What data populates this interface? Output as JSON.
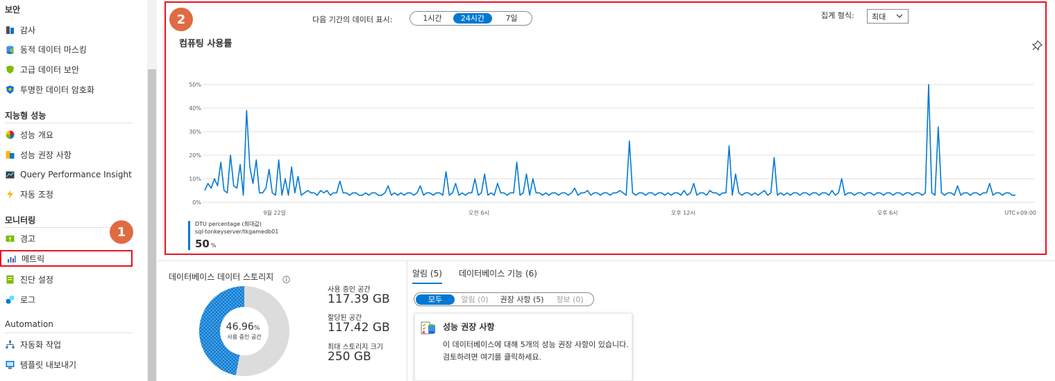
{
  "sidebar": {
    "sections": [
      {
        "title": "보안",
        "items": [
          {
            "label": "감사",
            "icon": "audit-icon"
          },
          {
            "label": "동적 데이터 마스킹",
            "icon": "data-masking-icon"
          },
          {
            "label": "고급 데이터 보안",
            "icon": "advanced-security-icon"
          },
          {
            "label": "투명한 데이터 암호화",
            "icon": "encryption-shield-icon"
          }
        ]
      },
      {
        "title": "지능형 성능",
        "items": [
          {
            "label": "성능 개요",
            "icon": "performance-overview-icon"
          },
          {
            "label": "성능 권장 사항",
            "icon": "performance-recommendations-icon"
          },
          {
            "label": "Query Performance Insight",
            "icon": "query-insight-icon"
          },
          {
            "label": "자동 조정",
            "icon": "lightning-icon"
          }
        ]
      },
      {
        "title": "모니터링",
        "items": [
          {
            "label": "경고",
            "icon": "alert-icon"
          },
          {
            "label": "메트릭",
            "icon": "metrics-icon",
            "selected": true
          },
          {
            "label": "진단 설정",
            "icon": "diagnostic-settings-icon"
          },
          {
            "label": "로그",
            "icon": "logs-icon"
          }
        ]
      },
      {
        "title": "Automation",
        "items": [
          {
            "label": "자동화 작업",
            "icon": "automation-tasks-icon"
          },
          {
            "label": "템플릿 내보내기",
            "icon": "export-template-icon"
          }
        ]
      }
    ]
  },
  "badges": {
    "one": "1",
    "two": "2",
    "color": "#e06b42"
  },
  "chart_panel": {
    "period_label": "다음 기간의 데이터 표시:",
    "period_options": [
      "1시간",
      "24시간",
      "7일"
    ],
    "period_selected": "24시간",
    "agg_label": "집계 형식:",
    "agg_value": "최대",
    "title": "컴퓨팅 사용률",
    "legend": {
      "metric": "DTU percentage (최대값)",
      "resource": "sql-tonkeyserver/tkgamedb01",
      "value": "50",
      "unit": "%"
    }
  },
  "chart_data": {
    "type": "line",
    "title": "컴퓨팅 사용률",
    "y_ticks": [
      "0%",
      "10%",
      "20%",
      "30%",
      "40%",
      "50%"
    ],
    "ylim": [
      0,
      50
    ],
    "x_tick_labels": [
      "9월 22일",
      "오전 6시",
      "오후 12시",
      "오후 6시"
    ],
    "timezone_label": "UTC+09:00",
    "grid": true,
    "series": [
      {
        "name": "DTU percentage (최대값)",
        "color": "#0078d4",
        "values": [
          5,
          8,
          6,
          10,
          7,
          17,
          5,
          4,
          20,
          7,
          6,
          16,
          3,
          39,
          15,
          8,
          18,
          4,
          4,
          6,
          14,
          4,
          3,
          18,
          3,
          10,
          3,
          15,
          4,
          11,
          3,
          4,
          5,
          4,
          4,
          3,
          5,
          4,
          5,
          3,
          4,
          4,
          9,
          4,
          4,
          3,
          4,
          4,
          3,
          3,
          4,
          3,
          4,
          4,
          3,
          3,
          4,
          7,
          3,
          4,
          3,
          4,
          3,
          4,
          4,
          3,
          4,
          7,
          3,
          4,
          4,
          3,
          4,
          4,
          3,
          13,
          3,
          4,
          8,
          3,
          4,
          3,
          4,
          4,
          10,
          3,
          4,
          12,
          3,
          4,
          3,
          8,
          4,
          4,
          3,
          4,
          4,
          17,
          3,
          4,
          12,
          3,
          10,
          4,
          4,
          3,
          4,
          3,
          4,
          4,
          3,
          4,
          4,
          3,
          4,
          6,
          3,
          4,
          4,
          5,
          3,
          4,
          4,
          3,
          4,
          4,
          3,
          4,
          4,
          5,
          4,
          3,
          26,
          4,
          3,
          4,
          4,
          3,
          4,
          4,
          3,
          4,
          4,
          3,
          4,
          3,
          4,
          4,
          3,
          5,
          3,
          4,
          8,
          3,
          4,
          4,
          3,
          5,
          4,
          4,
          3,
          4,
          4,
          24,
          3,
          12,
          4,
          3,
          4,
          4,
          3,
          4,
          3,
          4,
          5,
          3,
          4,
          19,
          3,
          4,
          3,
          4,
          3,
          4,
          4,
          3,
          4,
          4,
          3,
          4,
          4,
          3,
          4,
          4,
          3,
          5,
          3,
          4,
          10,
          3,
          4,
          4,
          3,
          4,
          4,
          3,
          4,
          4,
          3,
          4,
          4,
          3,
          4,
          4,
          3,
          4,
          4,
          3,
          4,
          4,
          3,
          4,
          4,
          3,
          4,
          50,
          4,
          3,
          32,
          4,
          3,
          4,
          4,
          3,
          7,
          3,
          4,
          4,
          3,
          4,
          4,
          3,
          4,
          4,
          8,
          3,
          4,
          4,
          3,
          4,
          4,
          3,
          3
        ]
      }
    ]
  },
  "storage": {
    "title": "데이터베이스 데이터 스토리지",
    "percent_value": "46.96",
    "percent_unit": "%",
    "percent_caption": "사용 중인 공간",
    "used_fraction": 0.4696,
    "used_label": "사용 중인 공간",
    "used_value": "117.39 GB",
    "allocated_label": "할당된 공간",
    "allocated_value": "117.42 GB",
    "max_label": "최대 스토리지 크기",
    "max_value": "250 GB"
  },
  "alerts": {
    "tabs": [
      "알림 (5)",
      "데이터베이스 기능 (6)"
    ],
    "active_tab": "알림 (5)",
    "filters": [
      "모두",
      "알림 (0)",
      "권장 사항 (5)",
      "정보 (0)"
    ],
    "active_filter": "모두",
    "card": {
      "title": "성능 권장 사항",
      "body": "이 데이터베이스에 대해 5개의 성능 권장 사항이 있습니다. 검토하려면 여기를 클릭하세요."
    }
  },
  "colors": {
    "accent": "#0078d4",
    "highlight_border": "#e81123"
  }
}
